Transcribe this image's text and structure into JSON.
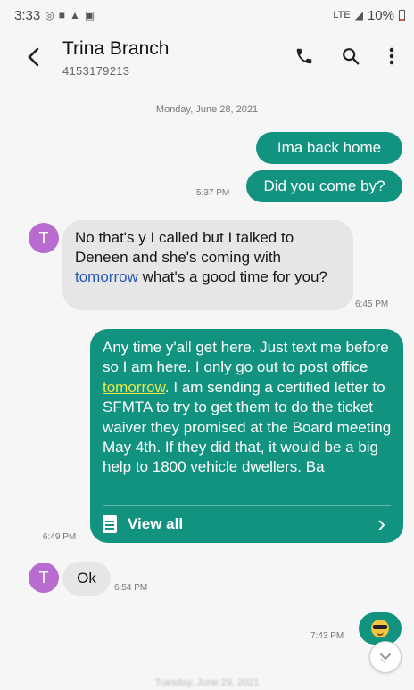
{
  "status_bar": {
    "time": "3:33",
    "icons": [
      "whatsapp-icon",
      "wallet-icon",
      "drive-icon",
      "image-icon"
    ],
    "network": "LTE",
    "battery": "10%"
  },
  "header": {
    "contact_name": "Trina Branch",
    "contact_number": "4153179213",
    "back_icon": "back-arrow-icon",
    "call_icon": "phone-icon",
    "search_icon": "search-icon",
    "more_icon": "more-vert-icon"
  },
  "conversation": {
    "date_separator": "Monday, June 28, 2021",
    "messages": [
      {
        "direction": "out",
        "text": "Ima back home"
      },
      {
        "direction": "out",
        "text": "Did you come by?",
        "time": "5:37 PM"
      },
      {
        "direction": "in",
        "avatar": "T",
        "text_before": "No that's y I called but I talked to Deneen and she's coming with",
        "link": "tomorrow",
        "text_after": "what's a good time for you?",
        "time": "6:45 PM"
      },
      {
        "direction": "out",
        "text_before": "Any time y'all get here.  Just text me before so I am here.  I only go out to post office",
        "link": "tomorrow",
        "text_after": ".  I am sending a certified letter to SFMTA to try to get them to do the ticket waiver they promised at the Board meeting May 4th.  If they did that, it would be a big help to 1800 vehicle dwellers.  Ba",
        "view_all_label": "View all",
        "time": "6:49 PM"
      },
      {
        "direction": "in",
        "avatar": "T",
        "text": "Ok",
        "time": "6:54 PM"
      },
      {
        "direction": "out",
        "emoji": "sunglasses-emoji",
        "time": "7:43 PM"
      }
    ],
    "next_date_separator": "Tuesday, June 29, 2021"
  },
  "scroll_to_bottom_icon": "chevron-down-icon",
  "colors": {
    "outgoing_bubble": "#11937f",
    "incoming_bubble": "#e6e6e6",
    "avatar": "#b86ccf",
    "incoming_link": "#2759b4",
    "outgoing_link": "#e8e84a"
  }
}
